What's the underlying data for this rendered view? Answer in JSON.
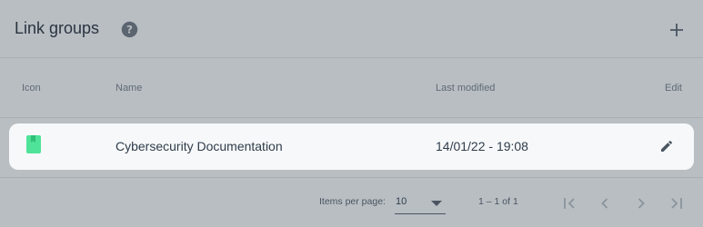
{
  "header": {
    "title": "Link groups",
    "help_icon": "help-icon",
    "add_icon": "add-icon"
  },
  "table": {
    "columns": [
      "Icon",
      "Name",
      "Last modified",
      "Edit"
    ],
    "rows": [
      {
        "icon": "book-icon",
        "name": "Cybersecurity Documentation",
        "last_modified": "14/01/22 - 19:08",
        "edit_icon": "edit-icon"
      }
    ]
  },
  "paginator": {
    "items_per_page_label": "Items per page:",
    "items_per_page_value": "10",
    "range_label": "1 – 1 of 1",
    "buttons": [
      "first-page-icon",
      "previous-page-icon",
      "next-page-icon",
      "last-page-icon"
    ]
  },
  "colors": {
    "overlay_bg": "#b9bec3",
    "row_bg": "#f7f8f9",
    "book_icon": "#4fe39a",
    "text_dark": "#2f3d4b",
    "text_muted": "#5f6975"
  }
}
